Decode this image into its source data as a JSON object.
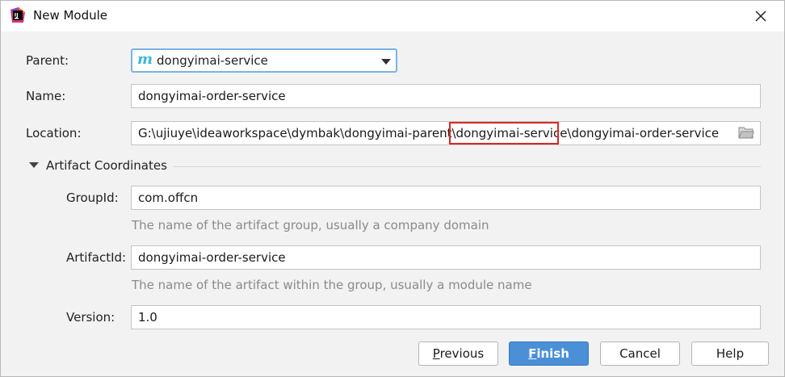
{
  "window": {
    "title": "New Module",
    "app_icon": "intellij-idea-icon",
    "close_icon": "close-icon"
  },
  "form": {
    "parent_label": "Parent:",
    "parent_icon_glyph": "m",
    "parent_value": "dongyimai-service",
    "name_label": "Name:",
    "name_value": "dongyimai-order-service",
    "location_label": "Location:",
    "location_value": "G:\\ujiuye\\ideaworkspace\\dymbak\\dongyimai-parent\\dongyimai-service\\dongyimai-order-service",
    "highlighted_segment": "dongyimai-service"
  },
  "artifact": {
    "section_label": "Artifact Coordinates",
    "groupid_label": "GroupId:",
    "groupid_value": "com.offcn",
    "groupid_hint": "The name of the artifact group, usually a company domain",
    "artifactid_label": "ArtifactId:",
    "artifactid_value": "dongyimai-order-service",
    "artifactid_hint": "The name of the artifact within the group, usually a module name",
    "version_label": "Version:",
    "version_value": "1.0"
  },
  "buttons": {
    "previous_mnemonic": "P",
    "previous_rest": "revious",
    "finish_mnemonic": "F",
    "finish_rest": "inish",
    "cancel": "Cancel",
    "help": "Help"
  },
  "colors": {
    "primary_button": "#4b8fd6",
    "highlight_box": "#d52a2a",
    "combo_focus": "#7ab3e6",
    "maven_icon": "#3fb5d9"
  }
}
